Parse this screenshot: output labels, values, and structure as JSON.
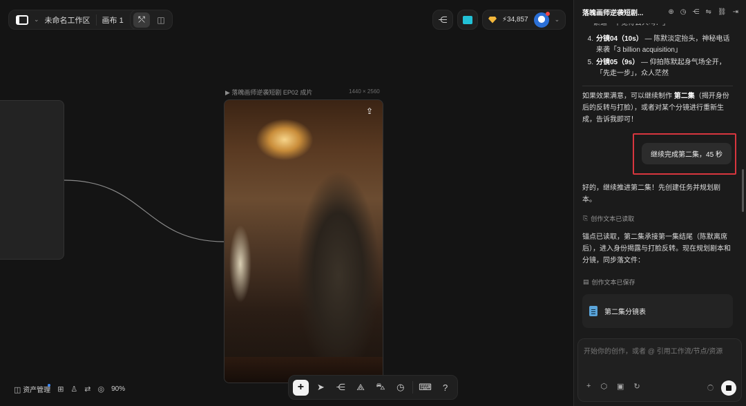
{
  "workspace": {
    "name": "未命名工作区",
    "canvas_name": "画布 1",
    "logo": "app-logo-icon"
  },
  "top_right": {
    "credits": "34,857"
  },
  "frame": {
    "label": "▶ 落魄画师逆袭短剧 EP02 成片",
    "size": "1440 × 2560"
  },
  "bottom_left": {
    "assets_label": "资产管理",
    "zoom": "90%"
  },
  "panel": {
    "title": "落魄画师逆袭短剧...",
    "outline_top_fragment": "紧逼「不觉得丢人吗？」",
    "outline": [
      {
        "num": "4.",
        "title": "分镜04（10s）",
        "text": " — 陈默淡定抬头，神秘电话",
        "cont": "来袭「3 billion acquisition」"
      },
      {
        "num": "5.",
        "title": "分镜05（9s）",
        "text": " — 仰拍陈默起身气场全开，",
        "cont": "「先走一步」，众人茫然"
      }
    ],
    "para1_a": "如果效果满意，可以继续制作 ",
    "para1_b": "第二集",
    "para1_c": "（揭开身份后的反转与打脸），或者对某个分镜进行重新生成，告诉我即可！",
    "user_message": "继续完成第二集，45 秒",
    "para2": "好的，继续推进第二集！先创建任务并规划剧本。",
    "status1": "创作文本已读取",
    "para3": "锚点已读取，第二集承接第一集结尾（陈默离席后），进入身份揭露与打脸反转。现在规划剧本和分镜，同步落文件：",
    "status2": "创作文本已保存",
    "doc_card": "第二集分镜表",
    "input_placeholder": "开始你的创作，或者 @ 引用工作流/节点/资源"
  }
}
